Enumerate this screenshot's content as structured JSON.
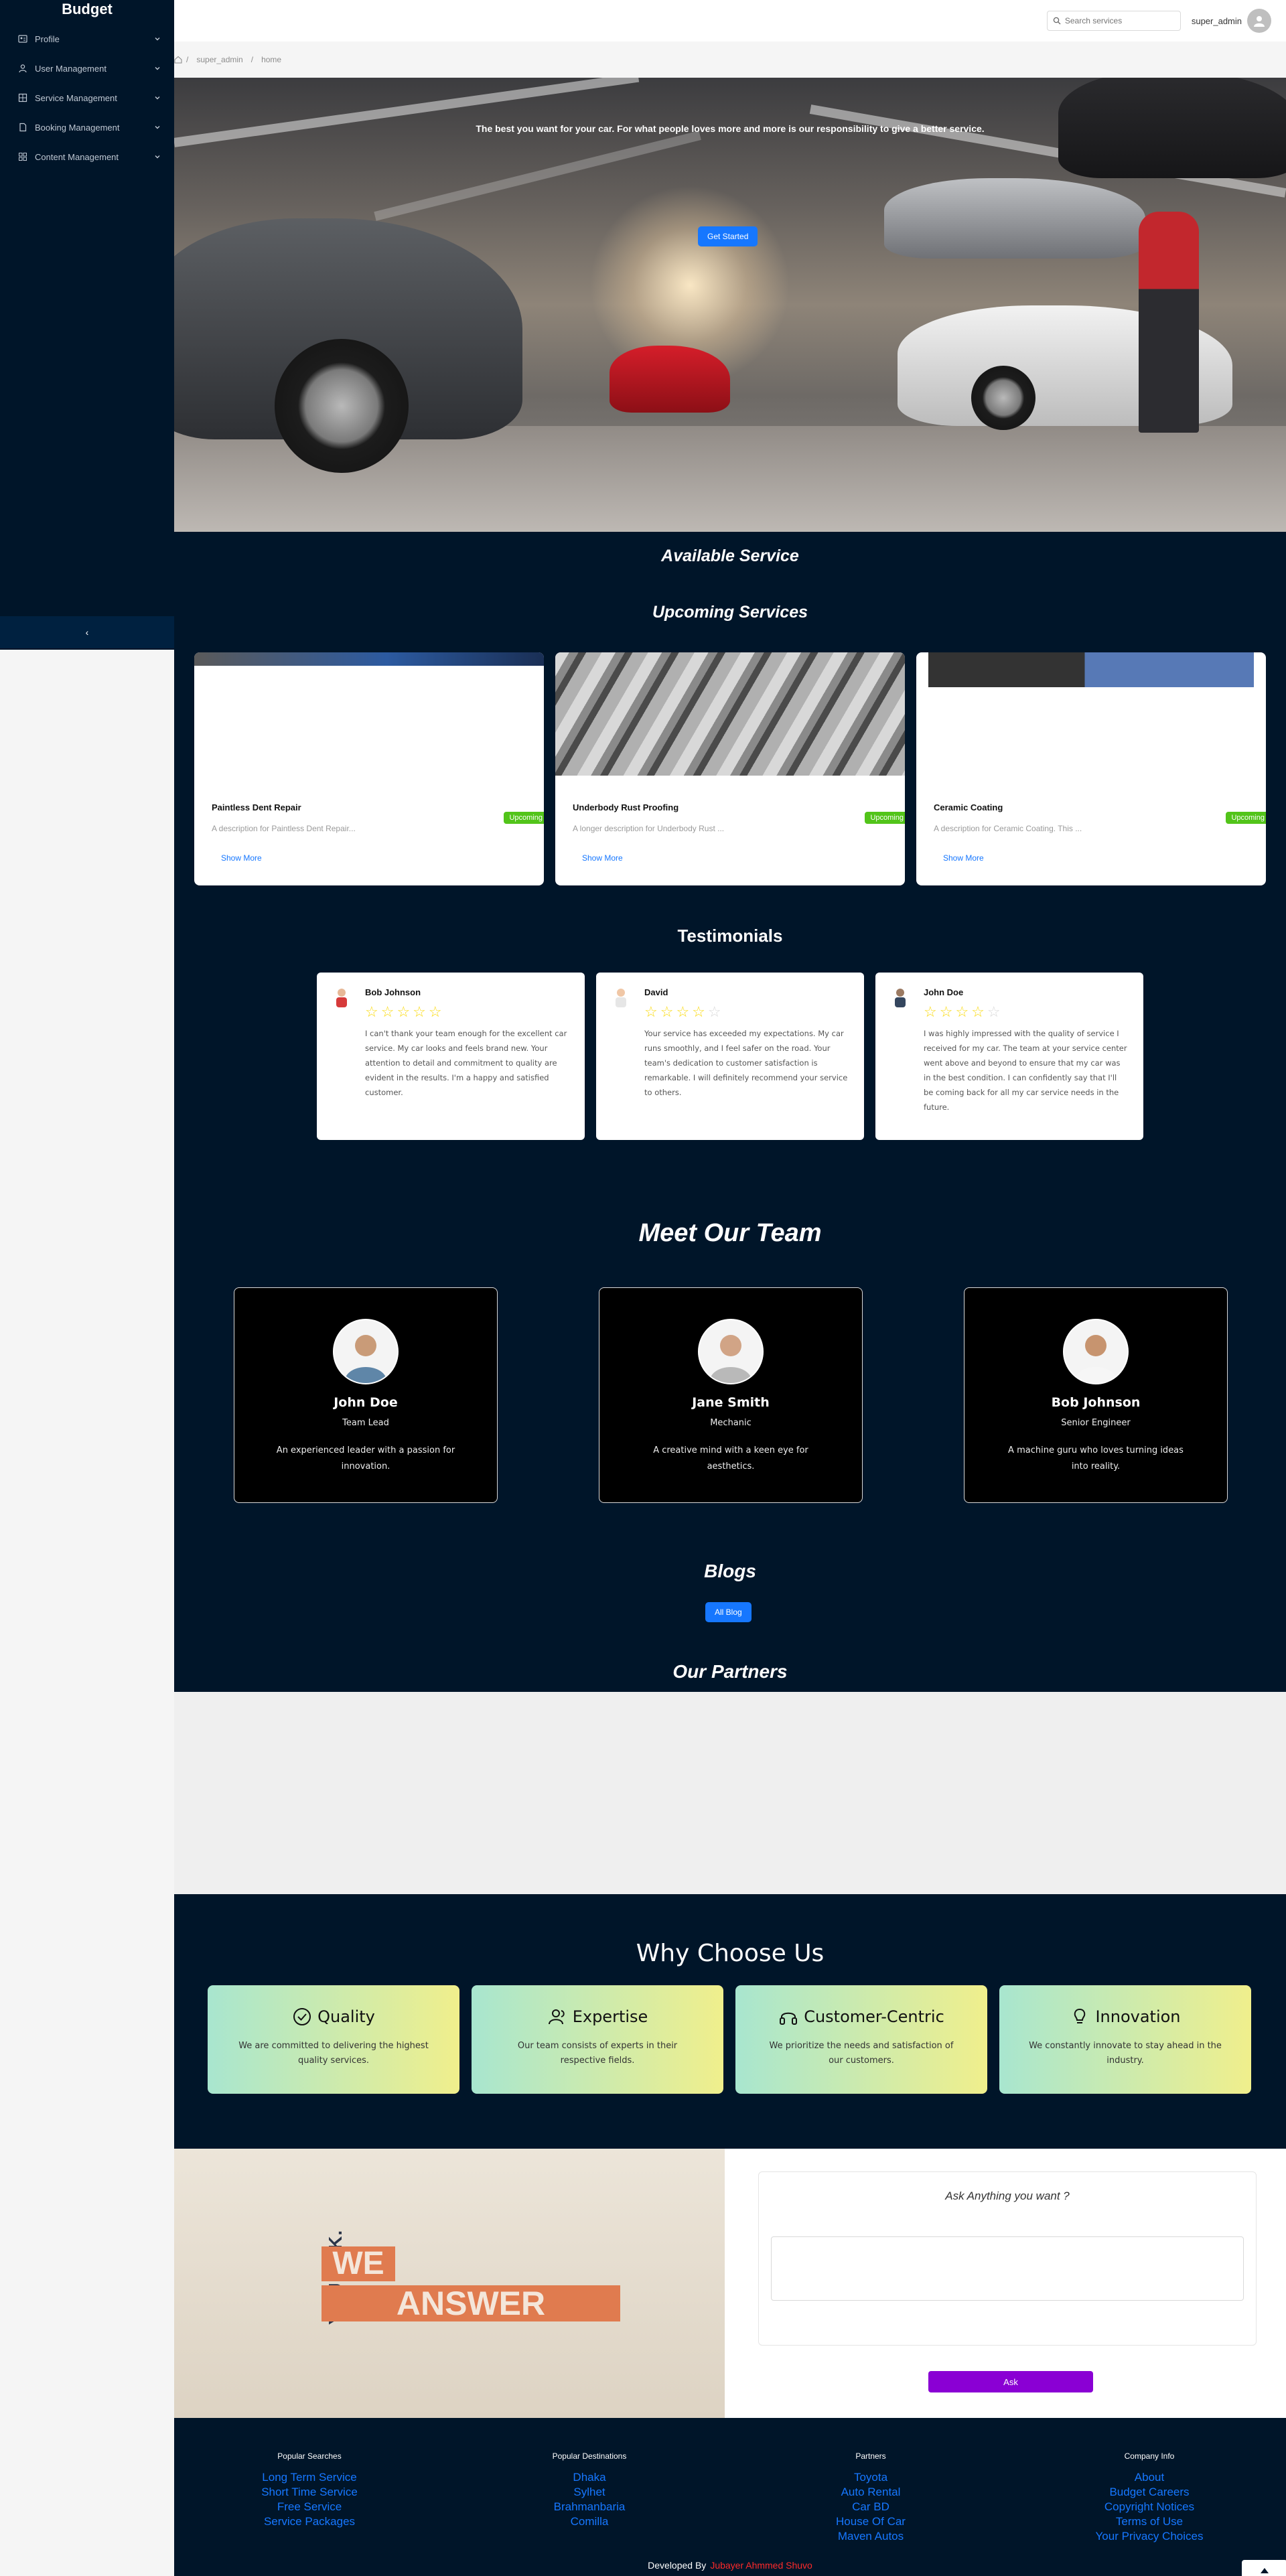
{
  "sidebar": {
    "brand": "Budget",
    "items": [
      {
        "label": "Profile",
        "icon": "profile-card-icon"
      },
      {
        "label": "User Management",
        "icon": "user-icon"
      },
      {
        "label": "Service Management",
        "icon": "grid-icon"
      },
      {
        "label": "Booking Management",
        "icon": "document-icon"
      },
      {
        "label": "Content Management",
        "icon": "appstore-icon"
      }
    ],
    "collapse_glyph": "‹"
  },
  "header": {
    "search_placeholder": "Search services",
    "username": "super_admin"
  },
  "breadcrumb": {
    "items": [
      "super_admin",
      "home"
    ],
    "separator": "/"
  },
  "hero": {
    "tagline": "The best you want for your car. For what people loves more and more is our responsibility to give a better service.",
    "cta_label": "Get Started"
  },
  "sections": {
    "available_title": "Available Service",
    "upcoming_title": "Upcoming Services",
    "testimonials_title": "Testimonials",
    "team_title": "Meet Our Team",
    "blogs_title": "Blogs",
    "blogs_button": "All Blog",
    "partners_title": "Our Partners",
    "why_title": "Why Choose Us"
  },
  "services": [
    {
      "title": "Paintless Dent Repair",
      "description": "A description for Paintless Dent Repair...",
      "more": "Show More",
      "badge": "Upcoming"
    },
    {
      "title": "Underbody Rust Proofing",
      "description": "A longer description for Underbody Rust ...",
      "more": "Show More",
      "badge": "Upcoming"
    },
    {
      "title": "Ceramic Coating",
      "description": "A description for Ceramic Coating. This ...",
      "more": "Show More",
      "badge": "Upcoming"
    }
  ],
  "testimonials": [
    {
      "name": "Bob Johnson",
      "rating": 5,
      "text": "I can't thank your team enough for the excellent car service. My car looks and feels brand new. Your attention to detail and commitment to quality are evident in the results. I'm a happy and satisfied customer."
    },
    {
      "name": "David",
      "rating": 4,
      "text": "Your service has exceeded my expectations. My car runs smoothly, and I feel safer on the road. Your team's dedication to customer satisfaction is remarkable. I will definitely recommend your service to others."
    },
    {
      "name": "John Doe",
      "rating": 4,
      "text": "I was highly impressed with the quality of service I received for my car. The team at your service center went above and beyond to ensure that my car was in the best condition. I can confidently say that I'll be coming back for all my car service needs in the future."
    }
  ],
  "team": [
    {
      "name": "John Doe",
      "role": "Team Lead",
      "bio": "An experienced leader with a passion for innovation."
    },
    {
      "name": "Jane Smith",
      "role": "Mechanic",
      "bio": "A creative mind with a keen eye for aesthetics."
    },
    {
      "name": "Bob Johnson",
      "role": "Senior Engineer",
      "bio": "A machine guru who loves turning ideas into reality."
    }
  ],
  "why": [
    {
      "title": "Quality",
      "icon": "check-circle-icon",
      "text": "We are committed to delivering the highest quality services."
    },
    {
      "title": "Expertise",
      "icon": "team-icon",
      "text": "Our team consists of experts in their respective fields."
    },
    {
      "title": "Customer-Centric",
      "icon": "headphones-icon",
      "text": "We prioritize the needs and satisfaction of our customers."
    },
    {
      "title": "Innovation",
      "icon": "bulb-icon",
      "text": "We constantly innovate to stay ahead in the industry."
    }
  ],
  "ask": {
    "poster_small": "YOU ASK.",
    "poster_line1": "WE",
    "poster_line2": "ANSWER",
    "label": "Ask Anything you want ?",
    "button": "Ask"
  },
  "footer": {
    "columns": [
      {
        "heading": "Popular Searches",
        "links": [
          "Long Term Service",
          "Short Time Service",
          "Free Service",
          "Service Packages"
        ]
      },
      {
        "heading": "Popular Destinations",
        "links": [
          "Dhaka",
          "Sylhet",
          "Brahmanbaria",
          "Comilla"
        ]
      },
      {
        "heading": "Partners",
        "links": [
          "Toyota",
          "Auto Rental",
          "Car BD",
          "House Of Car",
          "Maven Autos"
        ]
      },
      {
        "heading": "Company Info",
        "links": [
          "About",
          "Budget Careers",
          "Copyright Notices",
          "Terms of Use",
          "Your Privacy Choices"
        ]
      }
    ],
    "developed_by": "Developed By",
    "developer": "Jubayer Ahmmed Shuvo"
  },
  "colors": {
    "sidebar_bg": "#001529",
    "primary": "#1677ff",
    "badge_green": "#52c41a",
    "ask_purple": "#8a00d4",
    "poster_orange": "#e07b4f",
    "developer_red": "#ff2a2a"
  }
}
